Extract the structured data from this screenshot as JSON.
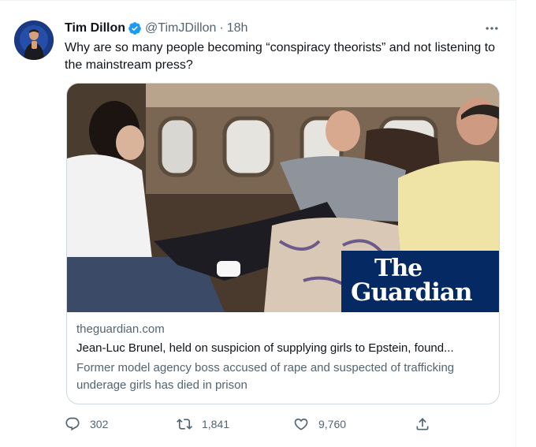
{
  "tweet": {
    "author_name": "Tim Dillon",
    "handle": "@TimJDillon",
    "separator": "·",
    "time": "18h",
    "text": "Why are so many people becoming “conspiracy theorists” and not listening to the mainstream press?"
  },
  "card": {
    "logo_line1": "The",
    "logo_line2": "Guardian",
    "domain": "theguardian.com",
    "title": "Jean-Luc Brunel, held on suspicion of supplying girls to Epstein, found...",
    "description": "Former model agency boss accused of rape and suspected of trafficking underage girls has died in prison"
  },
  "actions": {
    "replies": "302",
    "retweets": "1,841",
    "likes": "9,760"
  },
  "colors": {
    "verified": "#1d9bf0",
    "guardian_blue": "#052962",
    "secondary_text": "#536471"
  },
  "icons": {
    "avatar": "avatar",
    "verified": "verified-badge-icon",
    "more": "more-options-icon",
    "reply": "reply-icon",
    "retweet": "retweet-icon",
    "like": "heart-icon",
    "share": "share-icon"
  }
}
